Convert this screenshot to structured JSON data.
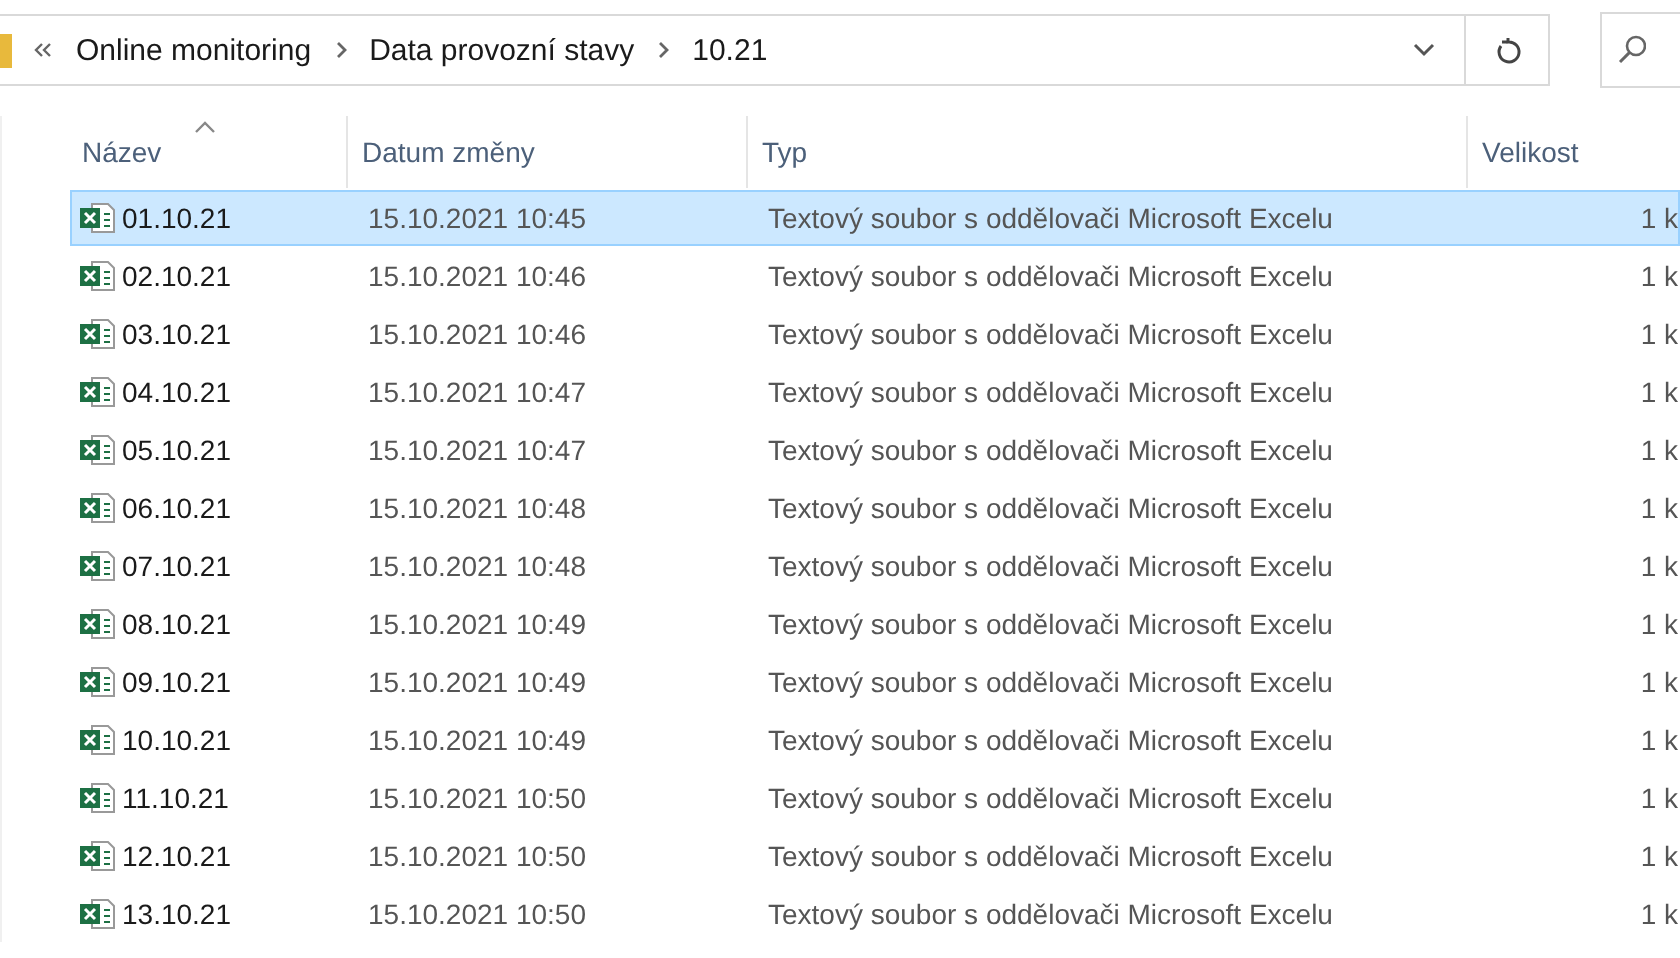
{
  "address_bar": {
    "path": [
      "Online monitoring",
      "Data provozní stavy",
      "10.21"
    ]
  },
  "table": {
    "columns": [
      "Název",
      "Datum změny",
      "Typ",
      "Velikost"
    ],
    "rows": [
      {
        "name": "01.10.21",
        "date": "15.10.2021 10:45",
        "type": "Textový soubor s oddělovači Microsoft Excelu",
        "size": "1 k",
        "selected": true
      },
      {
        "name": "02.10.21",
        "date": "15.10.2021 10:46",
        "type": "Textový soubor s oddělovači Microsoft Excelu",
        "size": "1 k",
        "selected": false
      },
      {
        "name": "03.10.21",
        "date": "15.10.2021 10:46",
        "type": "Textový soubor s oddělovači Microsoft Excelu",
        "size": "1 k",
        "selected": false
      },
      {
        "name": "04.10.21",
        "date": "15.10.2021 10:47",
        "type": "Textový soubor s oddělovači Microsoft Excelu",
        "size": "1 k",
        "selected": false
      },
      {
        "name": "05.10.21",
        "date": "15.10.2021 10:47",
        "type": "Textový soubor s oddělovači Microsoft Excelu",
        "size": "1 k",
        "selected": false
      },
      {
        "name": "06.10.21",
        "date": "15.10.2021 10:48",
        "type": "Textový soubor s oddělovači Microsoft Excelu",
        "size": "1 k",
        "selected": false
      },
      {
        "name": "07.10.21",
        "date": "15.10.2021 10:48",
        "type": "Textový soubor s oddělovači Microsoft Excelu",
        "size": "1 k",
        "selected": false
      },
      {
        "name": "08.10.21",
        "date": "15.10.2021 10:49",
        "type": "Textový soubor s oddělovači Microsoft Excelu",
        "size": "1 k",
        "selected": false
      },
      {
        "name": "09.10.21",
        "date": "15.10.2021 10:49",
        "type": "Textový soubor s oddělovači Microsoft Excelu",
        "size": "1 k",
        "selected": false
      },
      {
        "name": "10.10.21",
        "date": "15.10.2021 10:49",
        "type": "Textový soubor s oddělovači Microsoft Excelu",
        "size": "1 k",
        "selected": false
      },
      {
        "name": "11.10.21",
        "date": "15.10.2021 10:50",
        "type": "Textový soubor s oddělovači Microsoft Excelu",
        "size": "1 k",
        "selected": false
      },
      {
        "name": "12.10.21",
        "date": "15.10.2021 10:50",
        "type": "Textový soubor s oddělovači Microsoft Excelu",
        "size": "1 k",
        "selected": false
      },
      {
        "name": "13.10.21",
        "date": "15.10.2021 10:50",
        "type": "Textový soubor s oddělovači Microsoft Excelu",
        "size": "1 k",
        "selected": false
      }
    ]
  }
}
